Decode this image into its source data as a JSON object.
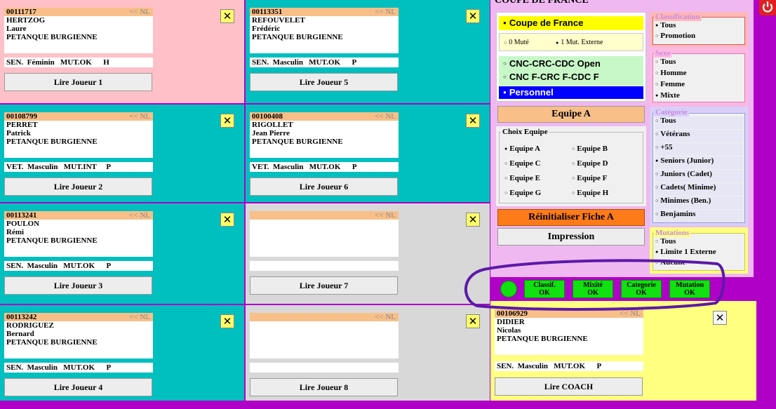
{
  "players": [
    {
      "id": "00111717",
      "nl": "<< NL",
      "last": "HERTZOG",
      "first": "Laure",
      "club": "PETANQUE BURGIENNE",
      "status": "SEN.  Féminin   MUT.OK      H",
      "button": "Lire Joueur 1"
    },
    {
      "id": "00113351",
      "nl": "<< NL",
      "last": "REFOUVELET",
      "first": "Frédéric",
      "club": "PETANQUE BURGIENNE",
      "status": "SEN.  Masculin   MUT.OK      P",
      "button": "Lire Joueur 5"
    },
    {
      "id": "00108799",
      "nl": "<< NL",
      "last": "PERRET",
      "first": "Patrick",
      "club": "PETANQUE BURGIENNE",
      "status": "VET.  Masculin   MUT.INT     P",
      "button": "Lire Joueur 2"
    },
    {
      "id": "00100408",
      "nl": "<< NL",
      "last": "RIGOLLET",
      "first": "Jean Pierre",
      "club": "PETANQUE BURGIENNE",
      "status": "VET.  Masculin   MUT.OK      P",
      "button": "Lire Joueur 6"
    },
    {
      "id": "00113241",
      "nl": "<< NL",
      "last": "POULON",
      "first": "Rémi",
      "club": "PETANQUE BURGIENNE",
      "status": "SEN.  Masculin   MUT.OK      P",
      "button": "Lire Joueur 3"
    },
    {
      "id": "",
      "nl": "<< NL",
      "last": "",
      "first": "",
      "club": "",
      "status": "",
      "button": "Lire Joueur 7"
    },
    {
      "id": "00113242",
      "nl": "<< NL",
      "last": "RODRIGUEZ",
      "first": "Bernard",
      "club": "PETANQUE BURGIENNE",
      "status": "SEN.  Masculin   MUT.OK      P",
      "button": "Lire Joueur 4"
    },
    {
      "id": "",
      "nl": "<< NL",
      "last": "",
      "first": "",
      "club": "",
      "status": "",
      "button": "Lire Joueur 8"
    }
  ],
  "coach": {
    "id": "00106929",
    "nl": "<< NL",
    "last": "DIDIER",
    "first": "Nicolas",
    "club": "PETANQUE BURGIENNE",
    "status": "SEN.  Masculin   MUT.OK      P",
    "button": "Lire COACH"
  },
  "close_glyph": "✕",
  "title": "COUPE DE FRANCE",
  "competition": {
    "coupe": "Coupe de France",
    "mute0": "0 Muté",
    "mute1": "1 Mut. Externe",
    "cnc_open": "CNC-CRC-CDC Open",
    "cnc_f": "CNC F-CRC F-CDC F",
    "personnel": "Personnel"
  },
  "equipe_banner": "Equipe A",
  "choix_equipe": {
    "legend": "Choix Equipe",
    "options": [
      "Equipe A",
      "Equipe B",
      "Equipe C",
      "Equipe D",
      "Equipe E",
      "Equipe F",
      "Equipe G",
      "Equipe H"
    ]
  },
  "reset_button": "Réinitialiser Fiche A",
  "print_button": "Impression",
  "classification": {
    "legend": "Classification",
    "options": [
      "Tous",
      "Promotion"
    ]
  },
  "sexe": {
    "legend": "Sexe",
    "options": [
      "Tous",
      "Homme",
      "Femme",
      "Mixte"
    ]
  },
  "categorie": {
    "legend": "Catégorie",
    "options": [
      "Tous",
      "Vétérans",
      "+55",
      "Seniors (Junior)",
      "Juniors (Cadet)",
      "Cadets( Minime)",
      "Minimes (Ben.)",
      "Benjamins"
    ]
  },
  "mutations": {
    "legend": "Mutations",
    "options": [
      "Tous",
      "Limite 1 Externe",
      "Aucune"
    ]
  },
  "checks": [
    {
      "line1": "Classif.",
      "line2": "OK"
    },
    {
      "line1": "Mixité",
      "line2": "OK"
    },
    {
      "line1": "Categorie",
      "line2": "OK"
    },
    {
      "line1": "Mutation",
      "line2": "OK"
    }
  ],
  "radio_on": "●",
  "radio_off": "○",
  "colors": {
    "background": "#b000c8",
    "pink": "#ffc0c8",
    "teal": "#00bfbf",
    "gray": "#d8d8d8",
    "yellow": "#ffff80",
    "header": "#f8bf88",
    "annotation": "#5a1aa8"
  }
}
